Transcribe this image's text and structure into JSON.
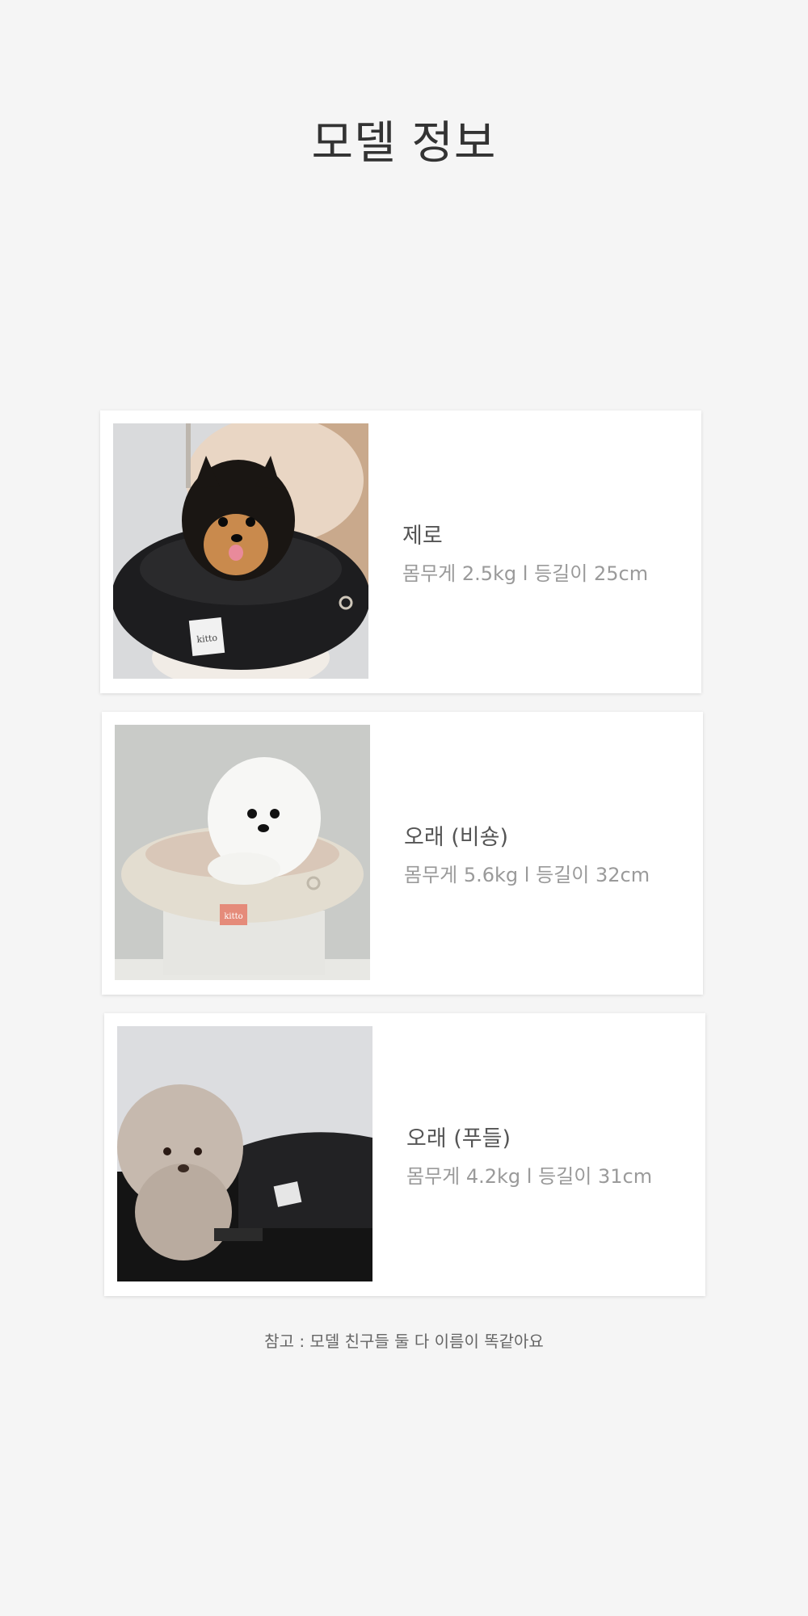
{
  "page": {
    "title": "모델 정보",
    "note": "참고 : 모델 친구들 둘 다 이름이 똑같아요"
  },
  "models": [
    {
      "name": "제로",
      "spec": "몸무게 2.5kg  l  등길이 25cm",
      "photo_icon": "pomeranian-photo"
    },
    {
      "name": "오래 (비숑)",
      "spec": "몸무게 5.6kg  l  등길이 32cm",
      "photo_icon": "bichon-photo"
    },
    {
      "name": "오래 (푸들)",
      "spec": "몸무게 4.2kg  l  등길이 31cm",
      "photo_icon": "poodle-photo"
    }
  ],
  "colors": {
    "background": "#f5f5f5",
    "card": "#ffffff",
    "title": "#333333",
    "name": "#555555",
    "spec": "#9a9a9a"
  }
}
